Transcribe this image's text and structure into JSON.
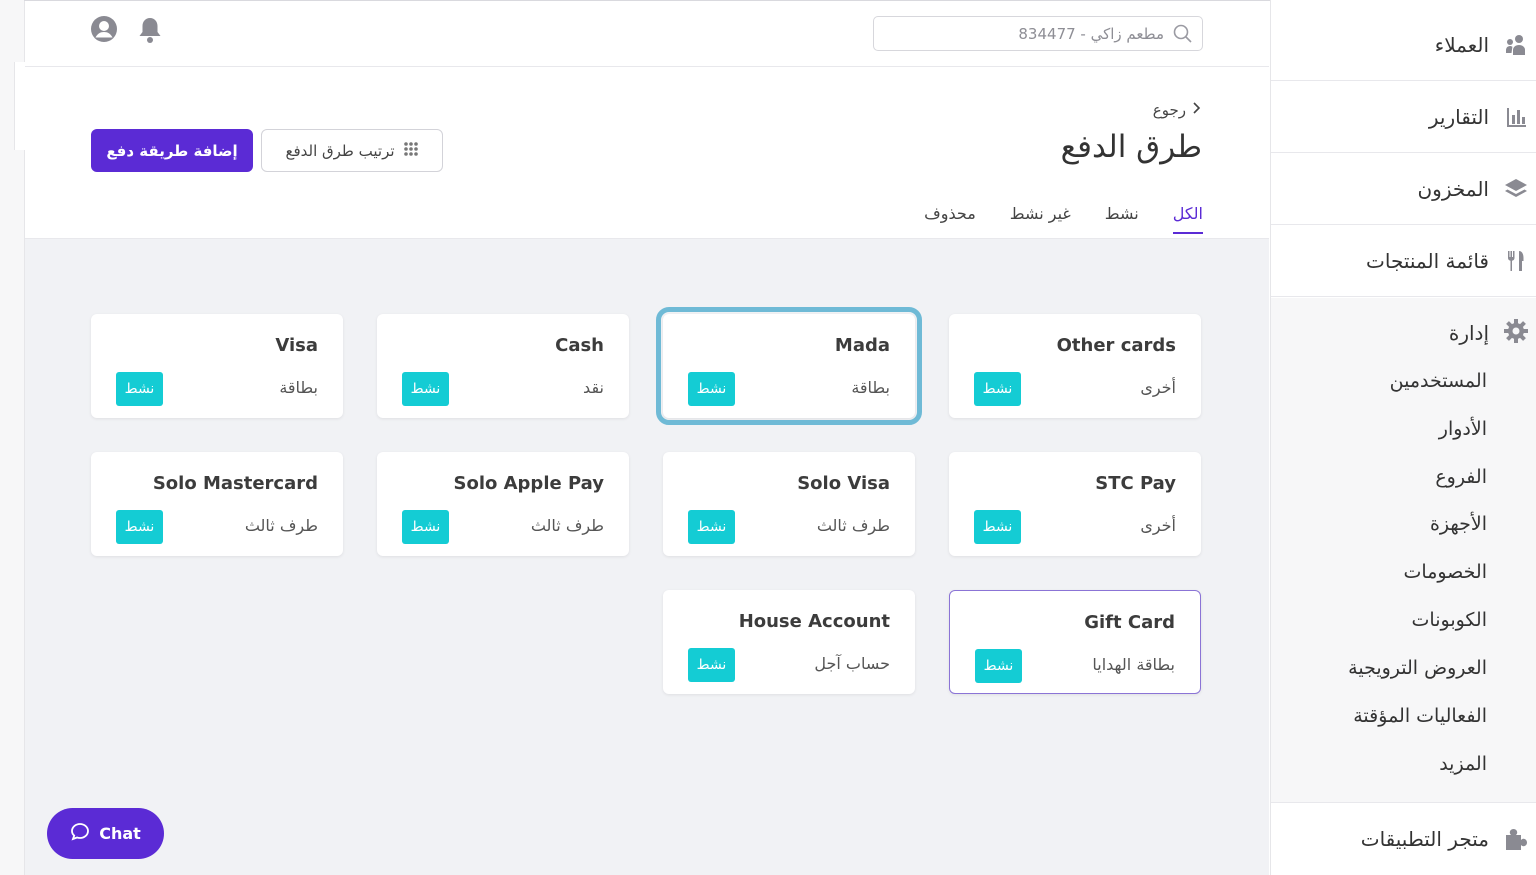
{
  "header": {
    "search_placeholder": "مطعم زاكي - 834477"
  },
  "page": {
    "back_label": "رجوع",
    "title": "طرق الدفع",
    "add_button": "إضافة طريقة دفع",
    "sort_button": "ترتيب طرق الدفع",
    "tabs": [
      "الكل",
      "نشط",
      "غير نشط",
      "محذوف"
    ],
    "active_tab": "الكل"
  },
  "cards": [
    {
      "name": "Other cards",
      "type": "أخرى",
      "status": "نشط"
    },
    {
      "name": "Mada",
      "type": "بطاقة",
      "status": "نشط"
    },
    {
      "name": "Cash",
      "type": "نقد",
      "status": "نشط"
    },
    {
      "name": "Visa",
      "type": "بطاقة",
      "status": "نشط"
    },
    {
      "name": "STC Pay",
      "type": "أخرى",
      "status": "نشط"
    },
    {
      "name": "Solo Visa",
      "type": "طرف ثالث",
      "status": "نشط"
    },
    {
      "name": "Solo Apple Pay",
      "type": "طرف ثالث",
      "status": "نشط"
    },
    {
      "name": "Solo Mastercard",
      "type": "طرف ثالث",
      "status": "نشط"
    },
    {
      "name": "Gift Card",
      "type": "بطاقة الهدايا",
      "status": "نشط"
    },
    {
      "name": "House Account",
      "type": "حساب آجل",
      "status": "نشط"
    }
  ],
  "sidebar": {
    "customers": "العملاء",
    "reports": "التقارير",
    "inventory": "المخزون",
    "menu": "قائمة المنتجات",
    "admin": "إدارة",
    "admin_items": [
      "المستخدمين",
      "الأدوار",
      "الفروع",
      "الأجهزة",
      "الخصومات",
      "الكوبونات",
      "العروض الترويجية",
      "الفعاليات المؤقتة",
      "المزيد"
    ],
    "marketplace": "متجر التطبيقات"
  },
  "chat_label": "Chat",
  "colors": {
    "accent": "#5b2bd5",
    "status_active": "#14ccd4",
    "highlight_border": "#6fbad6",
    "content_bg": "#f1f2f5"
  },
  "icons": [
    "search-icon",
    "user-icon",
    "bell-icon",
    "chevron-right-icon",
    "grid-icon",
    "customers-icon",
    "reports-icon",
    "inventory-icon",
    "menu-icon",
    "gear-icon",
    "puzzle-icon",
    "chat-icon"
  ]
}
